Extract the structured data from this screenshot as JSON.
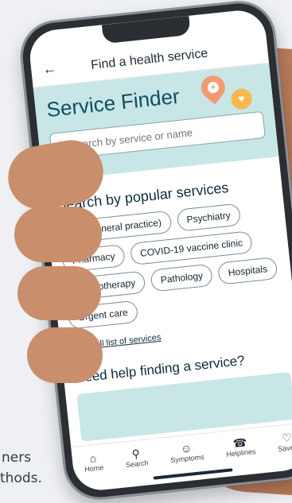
{
  "background_text": {
    "line1": "ners",
    "line2": "thods."
  },
  "appbar": {
    "back_icon": "arrow-left",
    "title": "Find a health service"
  },
  "hero": {
    "title": "Service Finder",
    "pin_icon": "+",
    "heart_icon": "♥"
  },
  "search": {
    "placeholder": "Search by service or name",
    "icon": "search-icon"
  },
  "popular": {
    "heading": "Search by popular services",
    "chips": [
      "GP (General practice)",
      "Psychiatry",
      "Pharmacy",
      "COVID-19 vaccine clinic",
      "Physiotherapy",
      "Pathology",
      "Hospitals",
      "Urgent care"
    ],
    "view_all_link": "View full list of services"
  },
  "help": {
    "heading": "Need help finding a service?"
  },
  "tabbar": {
    "tabs": [
      {
        "label": "Home",
        "icon": "home-icon"
      },
      {
        "label": "Search",
        "icon": "search-icon"
      },
      {
        "label": "Symptoms",
        "icon": "person-icon"
      },
      {
        "label": "Helplines",
        "icon": "phone-icon"
      },
      {
        "label": "Saved",
        "icon": "heart-icon"
      }
    ]
  },
  "colors": {
    "accent": "#0e4f61",
    "hero_bg": "#c8e6e6",
    "pin": "#f49a73",
    "heart": "#f8b84e"
  }
}
